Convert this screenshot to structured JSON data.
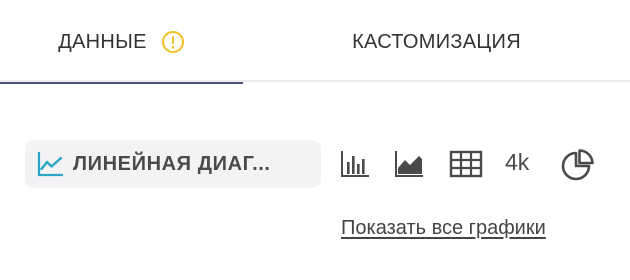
{
  "tabs": {
    "data_label": "ДАННЫЕ",
    "customization_label": "КАСТОМИЗАЦИЯ",
    "warning_icon": "warning-circle-icon",
    "warning_color": "#f0c020",
    "active_color": "#4b557e"
  },
  "chart_selector": {
    "selected_label": "ЛИНЕЙНАЯ ДИАГ...",
    "selected_icon": "line-chart-icon",
    "selected_icon_color": "#2aa5c4",
    "options": [
      {
        "icon": "bar-chart-icon"
      },
      {
        "icon": "area-chart-icon"
      },
      {
        "icon": "table-icon"
      },
      {
        "icon": "number-icon",
        "text": "4k"
      },
      {
        "icon": "pie-chart-icon"
      }
    ],
    "show_all_label": "Показать все графики"
  }
}
